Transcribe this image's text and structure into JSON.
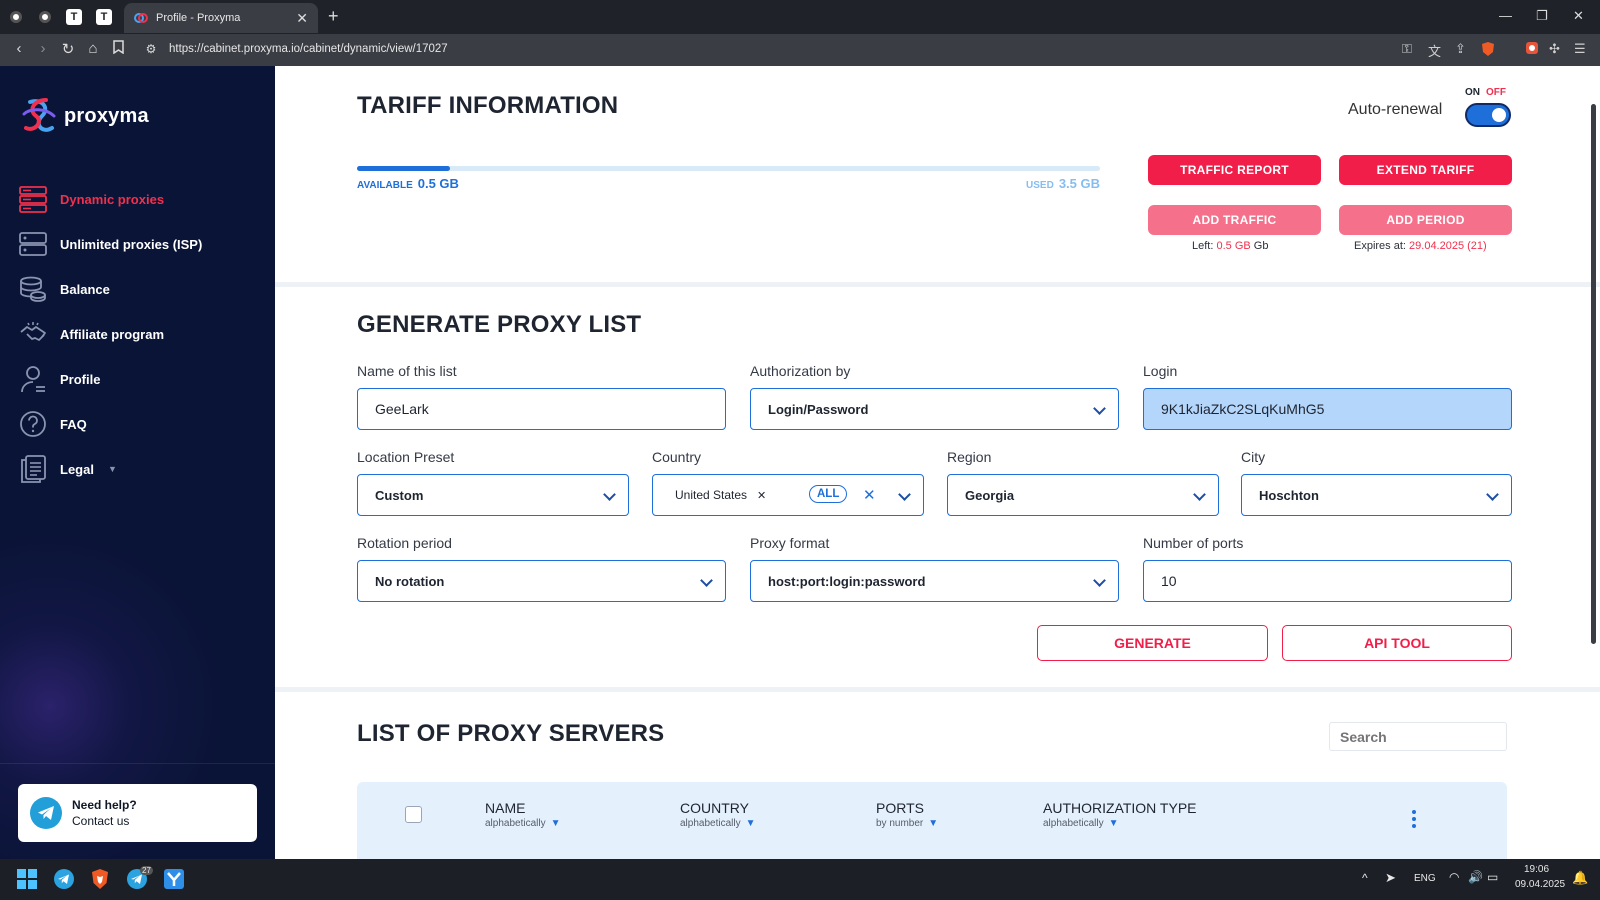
{
  "browser": {
    "tab_title": "Profile - Proxyma",
    "url": "https://cabinet.proxyma.io/cabinet/dynamic/view/17027",
    "pinned_tabs": [
      "circle-icon",
      "circle-icon",
      "t-icon",
      "t-icon"
    ]
  },
  "sidebar": {
    "logo": "proxyma",
    "items": [
      {
        "label": "Dynamic proxies",
        "icon": "server-stack-icon",
        "active": true
      },
      {
        "label": "Unlimited proxies (ISP)",
        "icon": "server-icon",
        "active": false
      },
      {
        "label": "Balance",
        "icon": "coins-icon",
        "active": false
      },
      {
        "label": "Affiliate program",
        "icon": "handshake-icon",
        "active": false
      },
      {
        "label": "Profile",
        "icon": "user-icon",
        "active": false
      },
      {
        "label": "FAQ",
        "icon": "question-icon",
        "active": false
      },
      {
        "label": "Legal",
        "icon": "document-icon",
        "active": false
      }
    ],
    "help": {
      "title": "Need help?",
      "subtitle": "Contact us"
    }
  },
  "tariff": {
    "title": "TARIFF INFORMATION",
    "available_label": "AVAILABLE",
    "available_value": "0.5 GB",
    "used_label": "USED",
    "used_value": "3.5 GB",
    "progress_fraction": 0.125,
    "auto_renewal_label": "Auto-renewal",
    "toggle_on": "ON",
    "toggle_off": "OFF",
    "buttons": {
      "traffic_report": "TRAFFIC REPORT",
      "extend_tariff": "EXTEND TARIFF",
      "add_traffic": "ADD TRAFFIC",
      "add_period": "ADD PERIOD"
    },
    "left_prefix": "Left:",
    "left_value": "0.5 GB",
    "left_suffix": "Gb",
    "expires_prefix": "Expires at:",
    "expires_value": "29.04.2025 (21)"
  },
  "generate": {
    "title": "GENERATE PROXY LIST",
    "name_label": "Name of this list",
    "name_value": "GeeLark",
    "auth_label": "Authorization by",
    "auth_value": "Login/Password",
    "login_label": "Login",
    "login_value": "9K1kJiaZkC2SLqKuMhG5",
    "preset_label": "Location Preset",
    "preset_value": "Custom",
    "country_label": "Country",
    "country_value": "United States",
    "country_all": "ALL",
    "region_label": "Region",
    "region_value": "Georgia",
    "city_label": "City",
    "city_value": "Hoschton",
    "rotation_label": "Rotation period",
    "rotation_value": "No rotation",
    "format_label": "Proxy format",
    "format_value": "host:port:login:password",
    "ports_label": "Number of ports",
    "ports_value": "10",
    "generate_btn": "GENERATE",
    "api_btn": "API TOOL"
  },
  "list": {
    "title": "LIST OF PROXY SERVERS",
    "search_placeholder": "Search",
    "columns": [
      {
        "title": "NAME",
        "sub": "alphabetically"
      },
      {
        "title": "COUNTRY",
        "sub": "alphabetically"
      },
      {
        "title": "PORTS",
        "sub": "by number"
      },
      {
        "title": "AUTHORIZATION TYPE",
        "sub": "alphabetically"
      }
    ]
  },
  "taskbar": {
    "lang": "ENG",
    "time": "19:06",
    "date": "09.04.2025",
    "badge": "27"
  },
  "colors": {
    "accent_red": "#f01e48",
    "accent_blue": "#1e6fd9",
    "sidebar_bg": "#0a1436"
  }
}
